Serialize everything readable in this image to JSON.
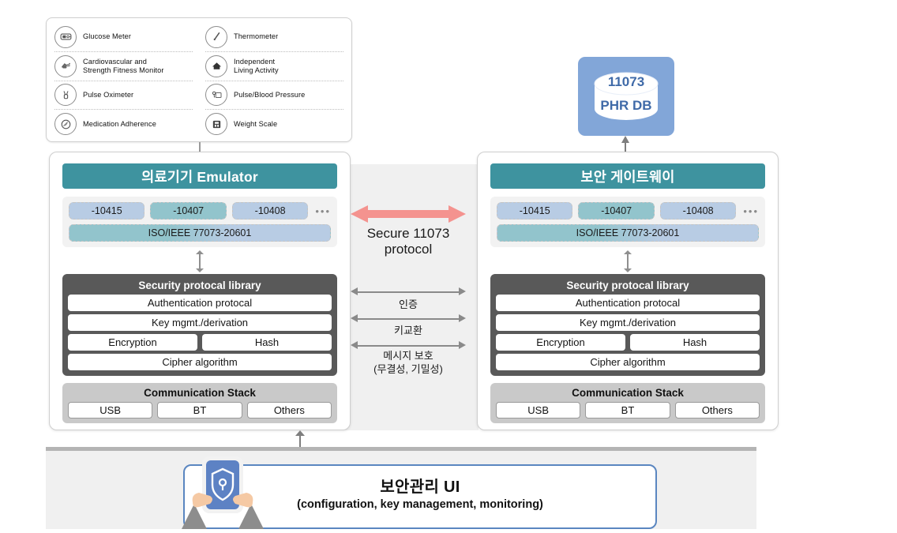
{
  "legend": {
    "left_items": [
      {
        "icon": "glucose-meter-icon",
        "label": "Glucose Meter"
      },
      {
        "icon": "cardio-fitness-monitor-icon",
        "label": "Cardiovascular and\nStrength Fitness Monitor"
      },
      {
        "icon": "pulse-oximeter-icon",
        "label": "Pulse Oximeter"
      },
      {
        "icon": "medication-adherence-icon",
        "label": "Medication Adherence"
      }
    ],
    "right_items": [
      {
        "icon": "thermometer-icon",
        "label": "Thermometer"
      },
      {
        "icon": "independent-living-activity-icon",
        "label": "Independent\nLiving Activity"
      },
      {
        "icon": "pulse-blood-pressure-icon",
        "label": "Pulse/Blood Pressure"
      },
      {
        "icon": "weight-scale-icon",
        "label": "Weight Scale"
      }
    ]
  },
  "phr_db": {
    "line1": "11073",
    "line2": "PHR DB",
    "box_color": "#82a6d8",
    "cylinder_color": "#ffffff",
    "text_color": "#3f6aa8"
  },
  "panels": [
    {
      "id": "device-emulator",
      "header": "의료기기 Emulator",
      "header_color": "#3e939f",
      "chips": [
        "-10415",
        "-10407",
        "-10408"
      ],
      "chip_more": "•••",
      "iso_bar": "ISO/IEEE 77073-20601",
      "security": {
        "title": "Security protocal library",
        "rows": [
          "Authentication protocal",
          "Key mgmt./derivation"
        ],
        "split_row": [
          "Encryption",
          "Hash"
        ],
        "last_row": "Cipher algorithm"
      },
      "comm": {
        "title": "Communication Stack",
        "items": [
          "USB",
          "BT",
          "Others"
        ]
      }
    },
    {
      "id": "security-gateway",
      "header": "보안 게이트웨이",
      "header_color": "#3e939f",
      "chips": [
        "-10415",
        "-10407",
        "-10408"
      ],
      "chip_more": "•••",
      "iso_bar": "ISO/IEEE 77073-20601",
      "security": {
        "title": "Security protocal library",
        "rows": [
          "Authentication protocal",
          "Key mgmt./derivation"
        ],
        "split_row": [
          "Encryption",
          "Hash"
        ],
        "last_row": "Cipher algorithm"
      },
      "comm": {
        "title": "Communication Stack",
        "items": [
          "USB",
          "BT",
          "Others"
        ]
      }
    }
  ],
  "middle": {
    "protocol_title_line1": "Secure 11073",
    "protocol_title_line2": "protocol",
    "arrow_color": "#f4938f",
    "flows": [
      {
        "label": "인증"
      },
      {
        "label": "키교환"
      },
      {
        "label": "메시지 보호"
      },
      {
        "label": "(무결성, 기밀성)"
      }
    ]
  },
  "bottom": {
    "title": "보안관리 UI",
    "subtitle": "(configuration, key management, monitoring)",
    "border_color": "#5a86c0",
    "phone_icon": "shield-lock-phone-icon"
  }
}
